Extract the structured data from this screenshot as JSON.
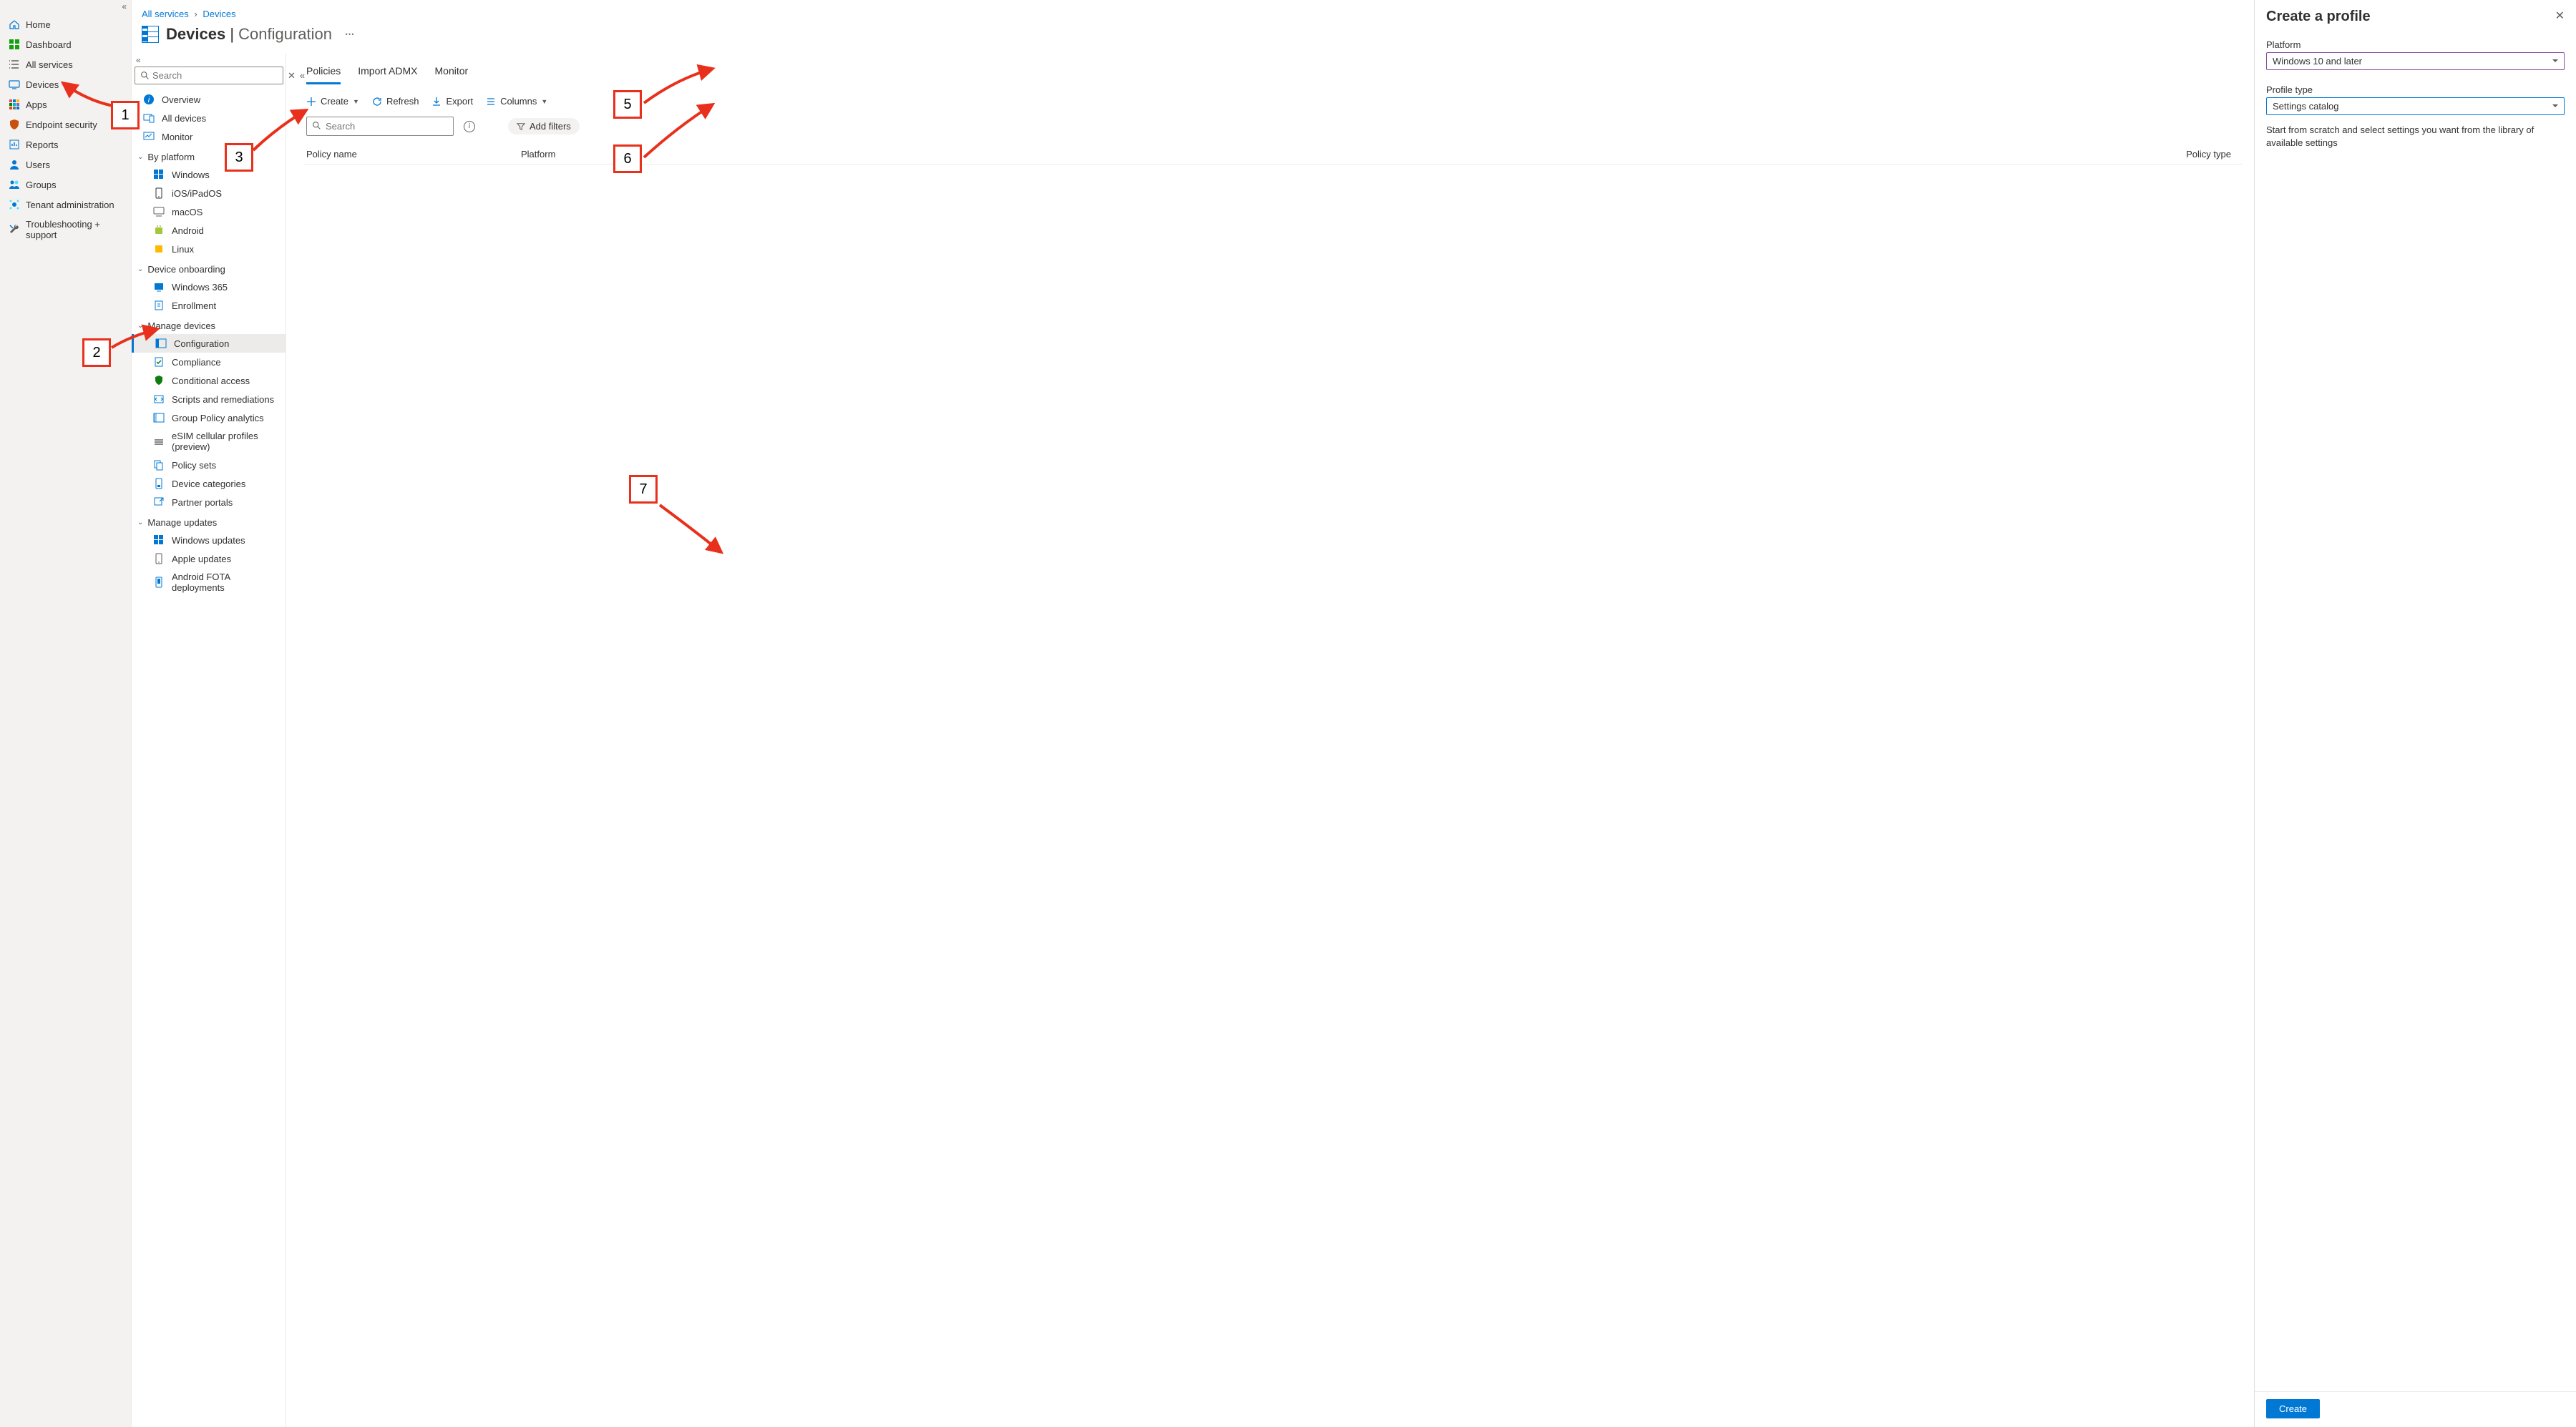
{
  "breadcrumb": {
    "root": "All services",
    "sep": "›",
    "current": "Devices"
  },
  "page": {
    "title": "Devices",
    "subtitle": "Configuration"
  },
  "leftnav": [
    {
      "id": "home",
      "label": "Home",
      "icon": "home",
      "color": "#0078d4"
    },
    {
      "id": "dashboard",
      "label": "Dashboard",
      "icon": "dashboard",
      "color": "#13a10e"
    },
    {
      "id": "allservices",
      "label": "All services",
      "icon": "list",
      "color": "#605e5c"
    },
    {
      "id": "devices",
      "label": "Devices",
      "icon": "device",
      "color": "#0078d4"
    },
    {
      "id": "apps",
      "label": "Apps",
      "icon": "apps",
      "color": "#0078d4"
    },
    {
      "id": "endpoint",
      "label": "Endpoint security",
      "icon": "shield",
      "color": "#ca5010"
    },
    {
      "id": "reports",
      "label": "Reports",
      "icon": "reports",
      "color": "#0078d4"
    },
    {
      "id": "users",
      "label": "Users",
      "icon": "users",
      "color": "#0078d4"
    },
    {
      "id": "groups",
      "label": "Groups",
      "icon": "groups",
      "color": "#0078d4"
    },
    {
      "id": "tenant",
      "label": "Tenant administration",
      "icon": "tenant",
      "color": "#0078d4"
    },
    {
      "id": "troubleshoot",
      "label": "Troubleshooting + support",
      "icon": "wrench",
      "color": "#605e5c"
    }
  ],
  "bladesearch": {
    "placeholder": "Search"
  },
  "bladenav": {
    "top": [
      {
        "id": "overview",
        "label": "Overview",
        "icon": "info"
      },
      {
        "id": "alldevices",
        "label": "All devices",
        "icon": "device"
      },
      {
        "id": "monitor",
        "label": "Monitor",
        "icon": "monitor"
      }
    ],
    "groups": [
      {
        "label": "By platform",
        "items": [
          {
            "id": "windows",
            "label": "Windows",
            "icon": "windows"
          },
          {
            "id": "ios",
            "label": "iOS/iPadOS",
            "icon": "ios"
          },
          {
            "id": "macos",
            "label": "macOS",
            "icon": "macos"
          },
          {
            "id": "android",
            "label": "Android",
            "icon": "android"
          },
          {
            "id": "linux",
            "label": "Linux",
            "icon": "linux"
          }
        ]
      },
      {
        "label": "Device onboarding",
        "items": [
          {
            "id": "w365",
            "label": "Windows 365",
            "icon": "w365"
          },
          {
            "id": "enroll",
            "label": "Enrollment",
            "icon": "enroll"
          }
        ]
      },
      {
        "label": "Manage devices",
        "items": [
          {
            "id": "config",
            "label": "Configuration",
            "icon": "config",
            "selected": true
          },
          {
            "id": "compliance",
            "label": "Compliance",
            "icon": "compliance"
          },
          {
            "id": "condaccess",
            "label": "Conditional access",
            "icon": "shield2"
          },
          {
            "id": "scripts",
            "label": "Scripts and remediations",
            "icon": "scripts"
          },
          {
            "id": "gpo",
            "label": "Group Policy analytics",
            "icon": "gpo"
          },
          {
            "id": "esim",
            "label": "eSIM cellular profiles (preview)",
            "icon": "esim"
          },
          {
            "id": "psets",
            "label": "Policy sets",
            "icon": "psets"
          },
          {
            "id": "devcat",
            "label": "Device categories",
            "icon": "devcat"
          },
          {
            "id": "partner",
            "label": "Partner portals",
            "icon": "partner"
          }
        ]
      },
      {
        "label": "Manage updates",
        "items": [
          {
            "id": "winup",
            "label": "Windows updates",
            "icon": "windows"
          },
          {
            "id": "appleup",
            "label": "Apple updates",
            "icon": "apple"
          },
          {
            "id": "fota",
            "label": "Android FOTA deployments",
            "icon": "android2"
          }
        ]
      }
    ]
  },
  "tabs": [
    {
      "id": "policies",
      "label": "Policies",
      "active": true
    },
    {
      "id": "admx",
      "label": "Import ADMX"
    },
    {
      "id": "monitortab",
      "label": "Monitor"
    }
  ],
  "toolbar": {
    "create": "Create",
    "refresh": "Refresh",
    "export": "Export",
    "columns": "Columns"
  },
  "policysearch": {
    "placeholder": "Search"
  },
  "addfilters": "Add filters",
  "columns": {
    "name": "Policy name",
    "platform": "Platform",
    "type": "Policy type"
  },
  "flyout": {
    "title": "Create a profile",
    "platform_label": "Platform",
    "platform_value": "Windows 10 and later",
    "profiletype_label": "Profile type",
    "profiletype_value": "Settings catalog",
    "hint": "Start from scratch and select settings you want from the library of available settings",
    "create_btn": "Create"
  },
  "annotations": {
    "b1": "1",
    "b2": "2",
    "b3": "3",
    "b5": "5",
    "b6": "6",
    "b7": "7"
  }
}
